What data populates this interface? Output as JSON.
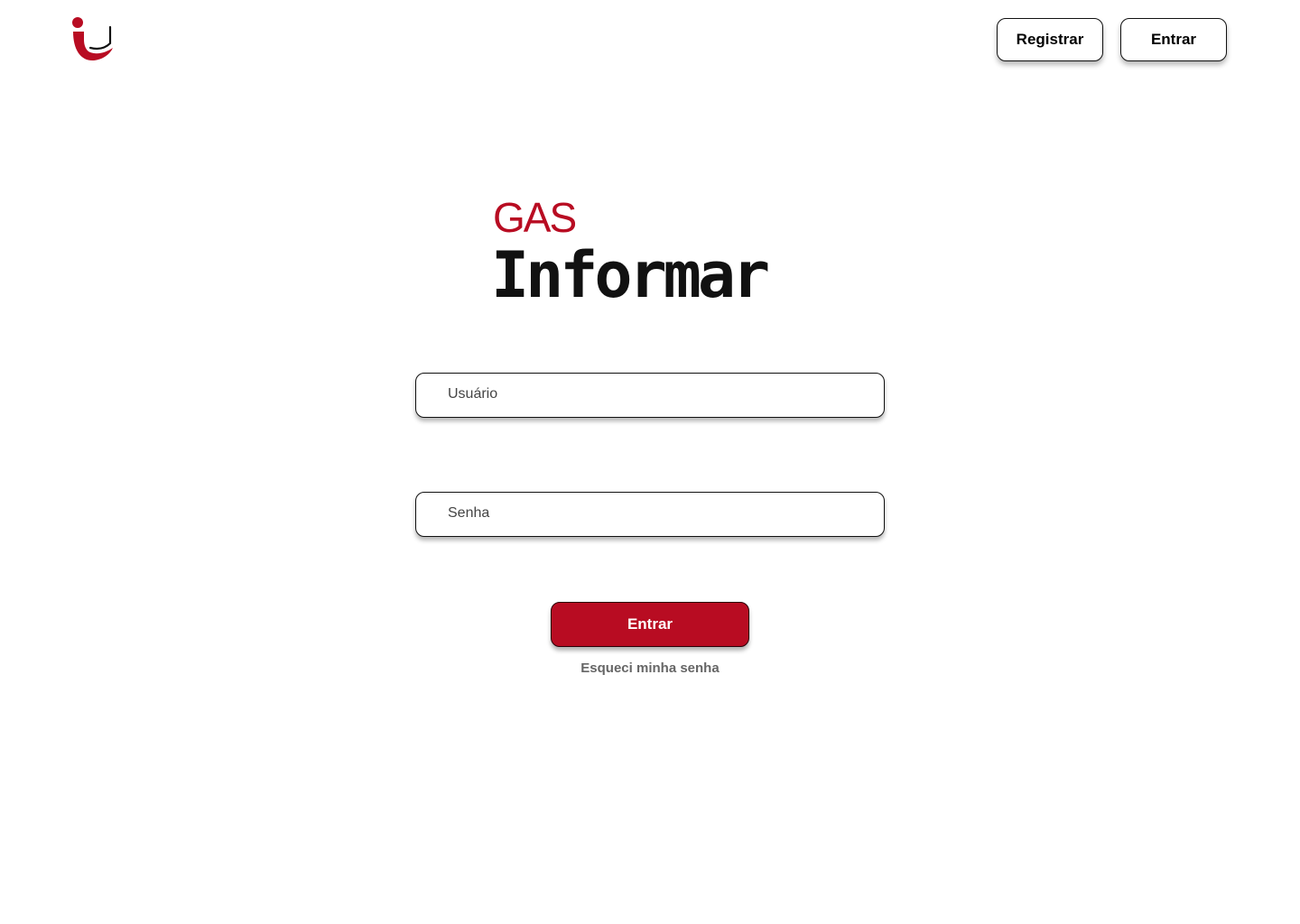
{
  "header": {
    "logo_icon": "smile-i-logo-icon",
    "register_label": "Registrar",
    "login_label": "Entrar"
  },
  "brand": {
    "line1": "GAS",
    "line2": "Informar"
  },
  "form": {
    "username_placeholder": "Usuário",
    "username_value": "",
    "password_placeholder": "Senha",
    "password_value": "",
    "submit_label": "Entrar",
    "forgot_label": "Esqueci minha senha"
  },
  "colors": {
    "accent": "#b80c22",
    "text": "#111111",
    "muted": "#666666"
  }
}
